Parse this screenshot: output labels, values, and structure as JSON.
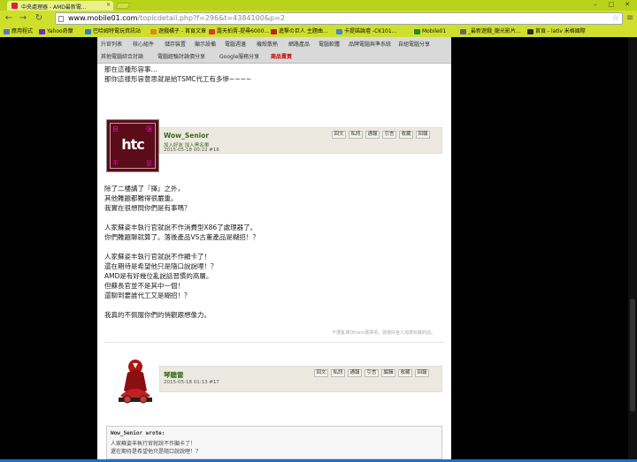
{
  "browser": {
    "tab_title": "中央處理器 - AMD最新電...",
    "url_host": "www.mobile01.com",
    "url_path": "/topicdetail.php?f=296&t=4384100&p=2",
    "bookmarks": [
      {
        "label": "應用程式",
        "color": "#5577cc"
      },
      {
        "label": "Yahoo奇摩",
        "color": "#6b2dbf"
      },
      {
        "label": "巴哈姆特電玩資訊站",
        "color": "#2a7fd0"
      },
      {
        "label": "遊戲橘子 - 首頁文章",
        "color": "#e08a10"
      },
      {
        "label": "露天拍賣-提尋6000...",
        "color": "#d83a2a"
      },
      {
        "label": "進擊の巨人 主題曲...",
        "color": "#c41f1f"
      },
      {
        "label": "卡提諾論壇 -CK101...",
        "color": "#3a8ad0"
      },
      {
        "label": "Mobile01",
        "color": "#1c8a2a"
      },
      {
        "label": "_最新遊戲_龍光影片...",
        "color": "#666666"
      },
      {
        "label": "首頁 - lativ 米格國際",
        "color": "#2a2a2a"
      }
    ]
  },
  "subnav": {
    "row1": [
      "升官列表",
      "核心組件",
      "儲存裝置",
      "顯示設備",
      "電腦週邊",
      "機殼散熱",
      "網路產品",
      "電腦軟體",
      "品牌電腦與準系統",
      "自組電腦分享"
    ],
    "row2": [
      "其他電腦綜合討論",
      "電腦經驗討論價分享",
      "Google服務分享",
      "商品賣買"
    ]
  },
  "post1": {
    "lines": [
      "那在這種形容事...",
      "那你這樣形容意思就是給TSMC代工有多慘~~~~"
    ]
  },
  "post2": {
    "author": "Wow_Senior",
    "links": "加入好友 加入黑名單",
    "date": "2015-05-18 00:22 #16",
    "avatar_text": {
      "tl": "自",
      "tr": "強",
      "bl": "不",
      "br": "息",
      "logo": "htc"
    },
    "actions": [
      "回文",
      "私訊",
      "通報",
      "引言",
      "收藏",
      "回報"
    ],
    "body": [
      {
        "text": "除了二樓講了『擇』之外，",
        "bold": false
      },
      {
        "text": "其他難題都難得很嚴重。",
        "bold": false
      },
      {
        "text": "我實在很想問你們是有事嗎？",
        "bold": false
      },
      {
        "text": "",
        "bold": false
      },
      {
        "text": "人家蘇姿丰執行官就說不作消費型X86了處理器了。",
        "bold": true
      },
      {
        "text": "你們難題聊就算了。落後產品VS古董產品是糊招！？",
        "bold": false
      },
      {
        "text": "",
        "bold": false
      },
      {
        "text": "人家蘇姿丰執行官就說不作顯卡了！",
        "bold": true
      },
      {
        "text": "還在期待是希望他只是隨口說說哩！？",
        "bold": false
      },
      {
        "text": "AMD是有好幾位亂說話習慣的高層。",
        "bold": false
      },
      {
        "text": "但蘇長官並不是其中一個！",
        "bold": false
      },
      {
        "text": "還聊到要誰代工又是糊招！？",
        "bold": false
      },
      {
        "text": "",
        "bold": false
      },
      {
        "text": "我真的不佩服你們的悄觀跟想像力。",
        "bold": false
      }
    ],
    "signature": "不要亂寫Others選擇項，請選好各人加選有趣的話。"
  },
  "post3": {
    "author": "琴聽雷",
    "date": "2015-05-18 01:13 #17",
    "actions": [
      "回文",
      "私訊",
      "通報",
      "引言",
      "編輯",
      "收藏",
      "回報"
    ],
    "quote_head": "Wow_Senior wrote:",
    "quote_lines": [
      "人家蘇姿丰執行官就說不作顯卡了！",
      "還在期待是希望他只是隨口說說哩！？"
    ]
  }
}
